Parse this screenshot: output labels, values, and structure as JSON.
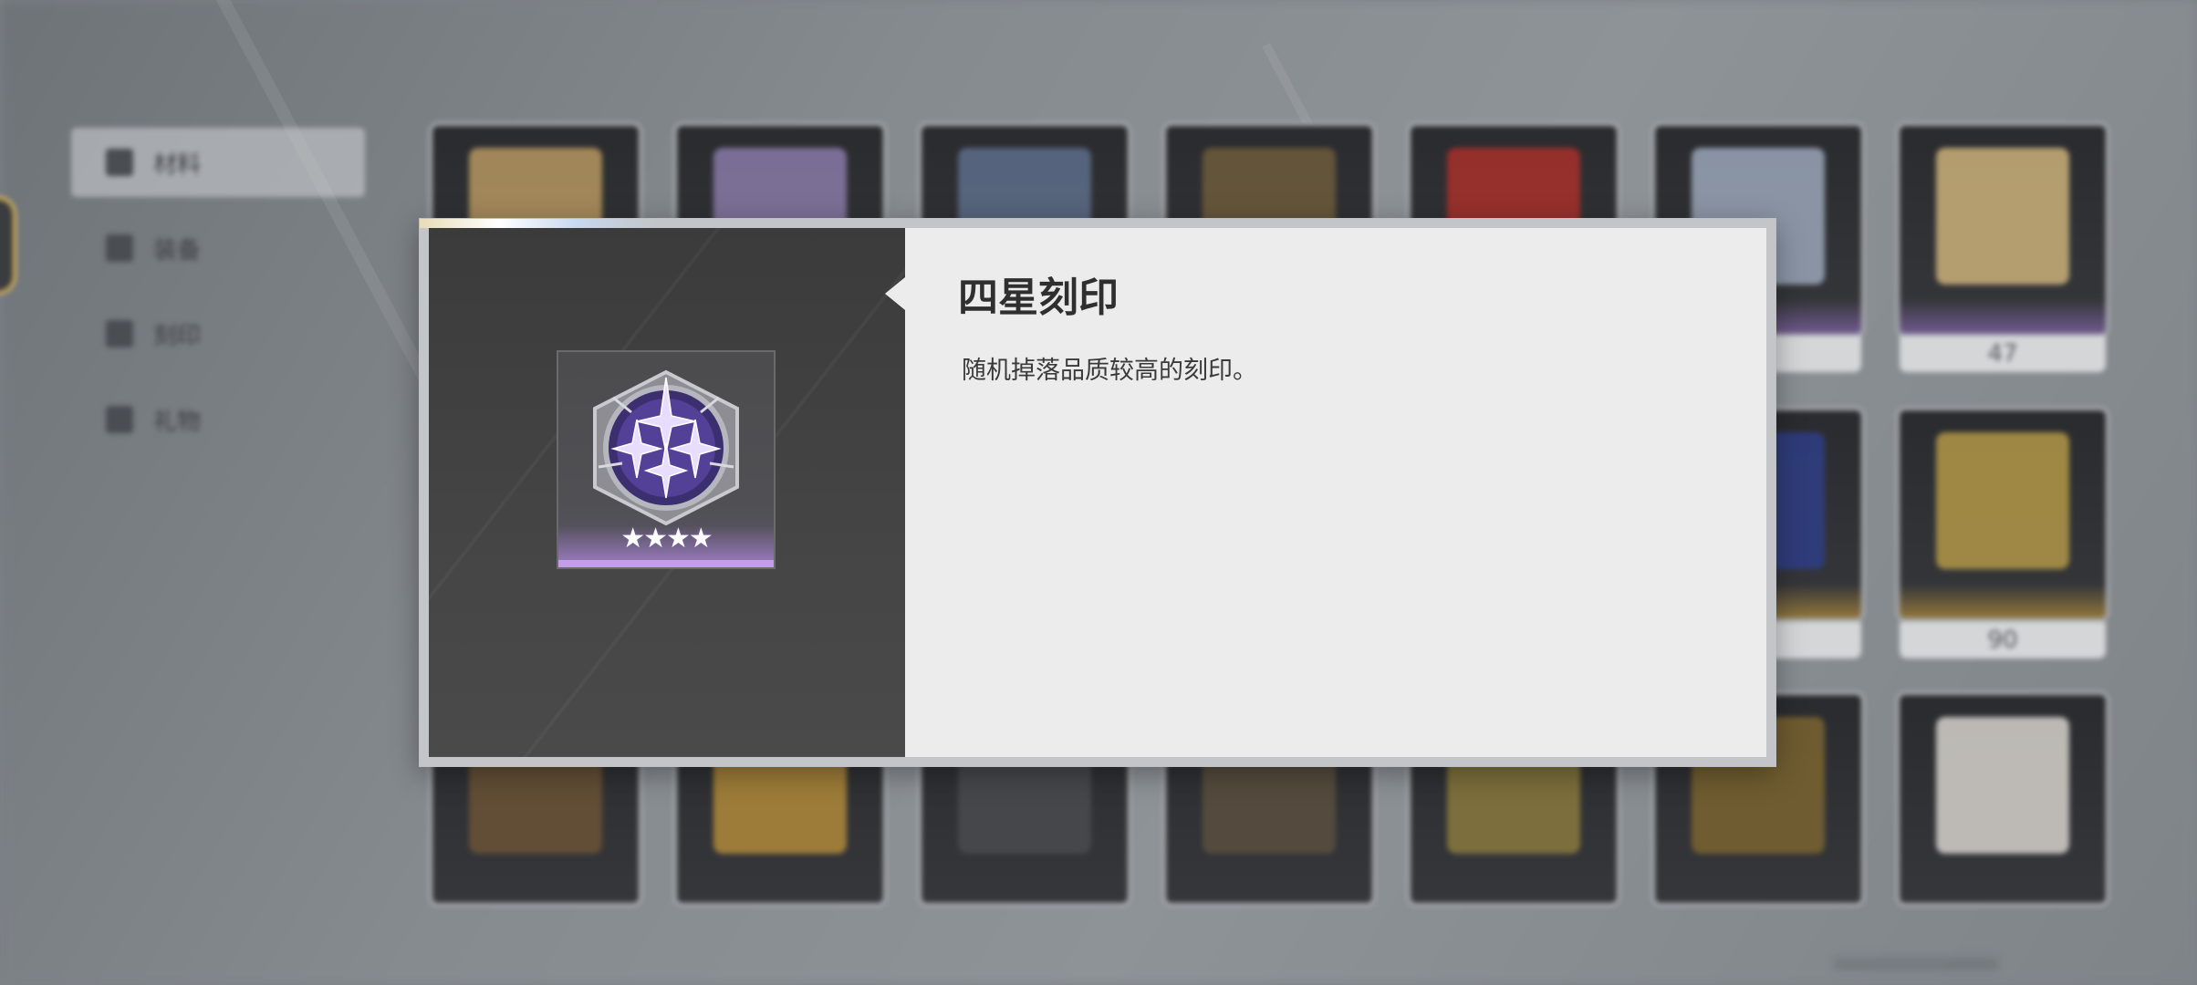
{
  "sidebar": {
    "items": [
      {
        "label": "材料",
        "icon": "material-icon",
        "active": true
      },
      {
        "label": "装备",
        "icon": "equipment-icon",
        "active": false
      },
      {
        "label": "刻印",
        "icon": "imprint-icon",
        "active": false
      },
      {
        "label": "礼物",
        "icon": "gift-icon",
        "active": false
      }
    ]
  },
  "inventory": {
    "visible_counts": [
      "47",
      "90"
    ]
  },
  "detail": {
    "title": "四星刻印",
    "description": "随机掉落品质较高的刻印。",
    "stars": "★★★★",
    "rarity_color": "#c49de8"
  }
}
